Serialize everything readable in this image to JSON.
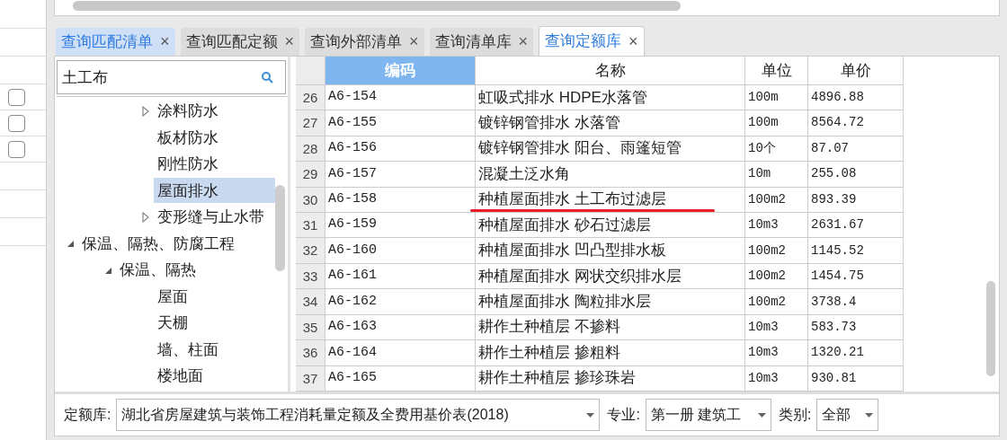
{
  "side_checkboxes": [
    {
      "checked": false
    },
    {
      "checked": false
    },
    {
      "checked": false
    }
  ],
  "tabs": [
    {
      "label": "查询匹配清单",
      "selected": false,
      "highlighted": true,
      "close": "×"
    },
    {
      "label": "查询匹配定额",
      "selected": false,
      "highlighted": false,
      "close": "×"
    },
    {
      "label": "查询外部清单",
      "selected": false,
      "highlighted": false,
      "close": "×"
    },
    {
      "label": "查询清单库",
      "selected": false,
      "highlighted": false,
      "close": "×"
    },
    {
      "label": "查询定额库",
      "selected": true,
      "highlighted": false,
      "close": "×"
    }
  ],
  "search": {
    "value": "土工布"
  },
  "tree": {
    "orphan_items": [
      {
        "label": "涂料防水",
        "expanded": false,
        "has_children": true,
        "selected": false
      },
      {
        "label": "板材防水",
        "has_children": false,
        "selected": false
      },
      {
        "label": "刚性防水",
        "has_children": false,
        "selected": false
      },
      {
        "label": "屋面排水",
        "has_children": false,
        "selected": true
      },
      {
        "label": "变形缝与止水带",
        "expanded": false,
        "has_children": true,
        "selected": false
      }
    ],
    "items": [
      {
        "label": "保温、隔热、防腐工程",
        "expanded": true,
        "has_children": true,
        "selected": false,
        "children": [
          {
            "label": "保温、隔热",
            "expanded": true,
            "has_children": true,
            "selected": false,
            "children": [
              {
                "label": "屋面",
                "has_children": false,
                "selected": false
              },
              {
                "label": "天棚",
                "has_children": false,
                "selected": false
              },
              {
                "label": "墙、柱面",
                "has_children": false,
                "selected": false
              },
              {
                "label": "楼地面",
                "has_children": false,
                "selected": false
              }
            ]
          }
        ]
      }
    ]
  },
  "table": {
    "columns": [
      {
        "label": "编码",
        "selected": true
      },
      {
        "label": "名称",
        "selected": false
      },
      {
        "label": "单位",
        "selected": false
      },
      {
        "label": "单价",
        "selected": false
      }
    ],
    "rows": [
      {
        "index": "26",
        "code": "A6-154",
        "name": "虹吸式排水 HDPE水落管",
        "unit": "100m",
        "price": "4896.88",
        "underlined": false
      },
      {
        "index": "27",
        "code": "A6-155",
        "name": "镀锌钢管排水 水落管",
        "unit": "100m",
        "price": "8564.72",
        "underlined": false
      },
      {
        "index": "28",
        "code": "A6-156",
        "name": "镀锌钢管排水 阳台、雨篷短管",
        "unit": "10个",
        "price": "87.07",
        "underlined": false
      },
      {
        "index": "29",
        "code": "A6-157",
        "name": "混凝土泛水角",
        "unit": "10m",
        "price": "255.08",
        "underlined": false
      },
      {
        "index": "30",
        "code": "A6-158",
        "name": "种植屋面排水 土工布过滤层",
        "unit": "100m2",
        "price": "893.39",
        "underlined": true
      },
      {
        "index": "31",
        "code": "A6-159",
        "name": "种植屋面排水 砂石过滤层",
        "unit": "10m3",
        "price": "2631.67",
        "underlined": false
      },
      {
        "index": "32",
        "code": "A6-160",
        "name": "种植屋面排水 凹凸型排水板",
        "unit": "100m2",
        "price": "1145.52",
        "underlined": false
      },
      {
        "index": "33",
        "code": "A6-161",
        "name": "种植屋面排水 网状交织排水层",
        "unit": "100m2",
        "price": "1454.75",
        "underlined": false
      },
      {
        "index": "34",
        "code": "A6-162",
        "name": "种植屋面排水 陶粒排水层",
        "unit": "100m2",
        "price": "3738.4",
        "underlined": false
      },
      {
        "index": "35",
        "code": "A6-163",
        "name": "耕作土种植层 不掺料",
        "unit": "10m3",
        "price": "583.73",
        "underlined": false
      },
      {
        "index": "36",
        "code": "A6-164",
        "name": "耕作土种植层 掺粗料",
        "unit": "10m3",
        "price": "1320.21",
        "underlined": false
      },
      {
        "index": "37",
        "code": "A6-165",
        "name": "耕作土种植层 掺珍珠岩",
        "unit": "10m3",
        "price": "930.81",
        "underlined": false
      }
    ]
  },
  "filters": [
    {
      "label": "定额库:",
      "value": "湖北省房屋建筑与装饰工程消耗量定额及全费用基价表(2018)"
    },
    {
      "label": "专业:",
      "value": "第一册 建筑工"
    },
    {
      "label": "类别:",
      "value": "全部"
    }
  ]
}
